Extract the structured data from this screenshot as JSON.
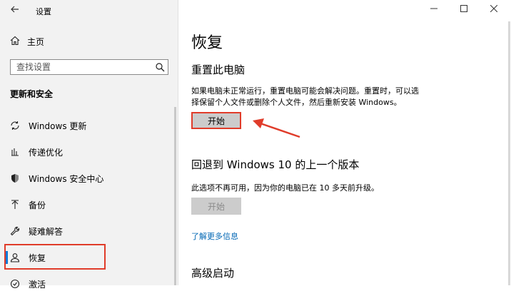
{
  "window": {
    "title": "设置"
  },
  "sidebar": {
    "home_label": "主页",
    "search_placeholder": "查找设置",
    "section_title": "更新和安全",
    "items": [
      {
        "label": "Windows 更新",
        "icon": "sync-icon"
      },
      {
        "label": "传递优化",
        "icon": "delivery-optimization-icon"
      },
      {
        "label": "Windows 安全中心",
        "icon": "shield-icon"
      },
      {
        "label": "备份",
        "icon": "backup-arrow-icon"
      },
      {
        "label": "疑难解答",
        "icon": "wrench-icon"
      },
      {
        "label": "恢复",
        "icon": "recovery-person-icon"
      },
      {
        "label": "激活",
        "icon": "activation-icon"
      }
    ],
    "selected_index": 5
  },
  "main": {
    "title": "恢复",
    "reset": {
      "heading": "重置此电脑",
      "description_line1": "如果电脑未正常运行，重置电脑可能会解决问题。重置时，可以选",
      "description_line2": "择保留个人文件或删除个人文件，然后重新安装 Windows。",
      "button_label": "开始"
    },
    "rollback": {
      "heading": "回退到 Windows 10 的上一个版本",
      "description": "此选项不再可用，因为你的电脑已在 10 多天前升级。",
      "button_label": "开始",
      "link_label": "了解更多信息"
    },
    "advanced": {
      "heading": "高级启动"
    }
  },
  "colors": {
    "accent": "#0078d7",
    "annotation": "#e03c2a",
    "link": "#0066b4"
  }
}
